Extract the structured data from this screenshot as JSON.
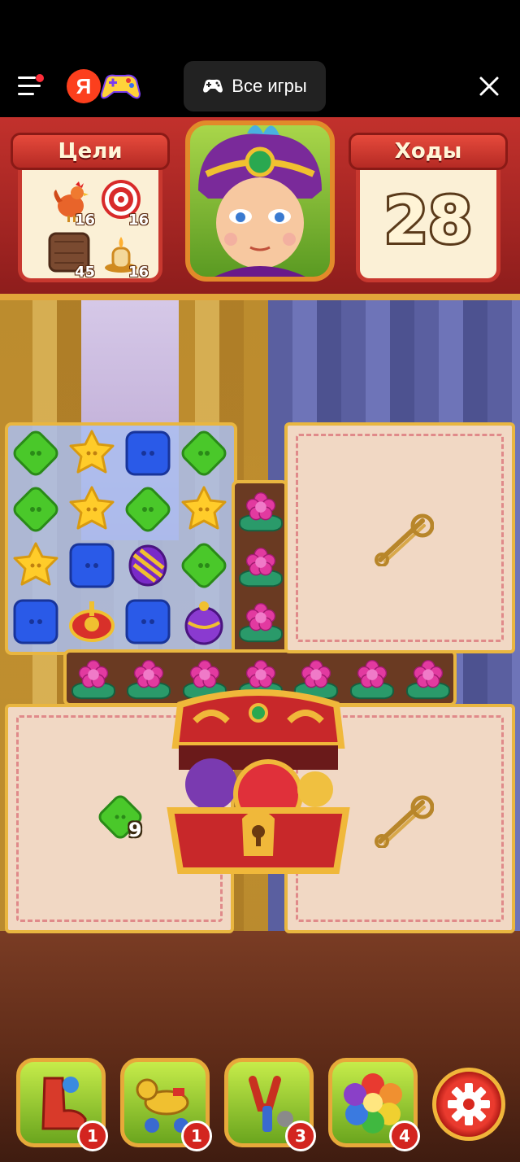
{
  "topbar": {
    "ya_letter": "Я",
    "all_games_label": "Все игры"
  },
  "hud": {
    "goals_title": "Цели",
    "moves_title": "Ходы",
    "moves_left": "28",
    "goals": [
      {
        "icon": "rooster-icon",
        "count": "16"
      },
      {
        "icon": "target-icon",
        "count": "16"
      },
      {
        "icon": "wood-crate-icon",
        "count": "45"
      },
      {
        "icon": "oil-lamp-icon",
        "count": "16"
      }
    ]
  },
  "board": {
    "grid": [
      [
        "green-button",
        "yellow-star",
        "blue-button",
        "green-button"
      ],
      [
        "green-button",
        "yellow-star",
        "green-button",
        "yellow-star"
      ],
      [
        "yellow-star",
        "blue-button",
        "striped-candy",
        "green-button"
      ],
      [
        "blue-button",
        "spinning-top",
        "blue-button",
        "purple-bomb"
      ]
    ],
    "collect_counter": "9"
  },
  "boosters": [
    {
      "icon": "boot-icon",
      "count": "1"
    },
    {
      "icon": "rocking-horse-icon",
      "count": "1"
    },
    {
      "icon": "slingshot-icon",
      "count": "3"
    },
    {
      "icon": "rainbow-flower-icon",
      "count": "4"
    }
  ],
  "colors": {
    "hud_red": "#c2312c",
    "gold": "#e9b640",
    "booster_green": "#6aa51e"
  }
}
